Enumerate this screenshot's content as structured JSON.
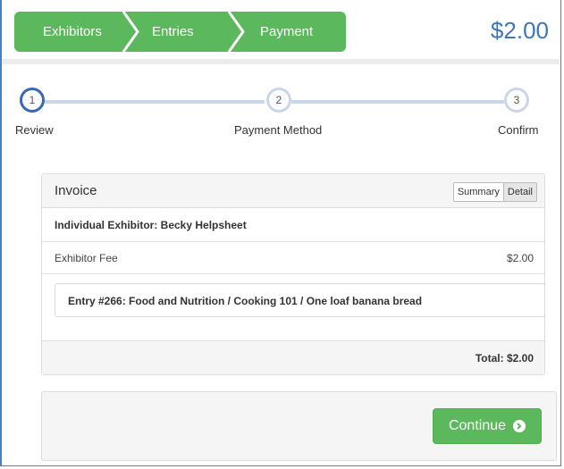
{
  "wizard": {
    "crumbs": [
      {
        "label": "Exhibitors"
      },
      {
        "label": "Entries"
      },
      {
        "label": "Payment"
      }
    ],
    "total": "$2.00",
    "accent": "#5cb85c",
    "total_color": "#3f76b8"
  },
  "steps": [
    {
      "number": "1",
      "label": "Review",
      "state": "active"
    },
    {
      "number": "2",
      "label": "Payment Method",
      "state": "pending"
    },
    {
      "number": "3",
      "label": "Confirm",
      "state": "pending"
    }
  ],
  "invoice": {
    "title": "Invoice",
    "view_toggle": {
      "summary": "Summary",
      "detail": "Detail",
      "selected": "Detail"
    },
    "exhibitor": "Individual Exhibitor: Becky Helpsheet",
    "fee_label": "Exhibitor Fee",
    "fee_amount": "$2.00",
    "entry": "Entry #266: Food and Nutrition / Cooking 101 / One loaf banana bread",
    "total": "Total: $2.00"
  },
  "actions": {
    "continue_label": "Continue",
    "continue_icon": "arrow-circle-right-icon"
  }
}
